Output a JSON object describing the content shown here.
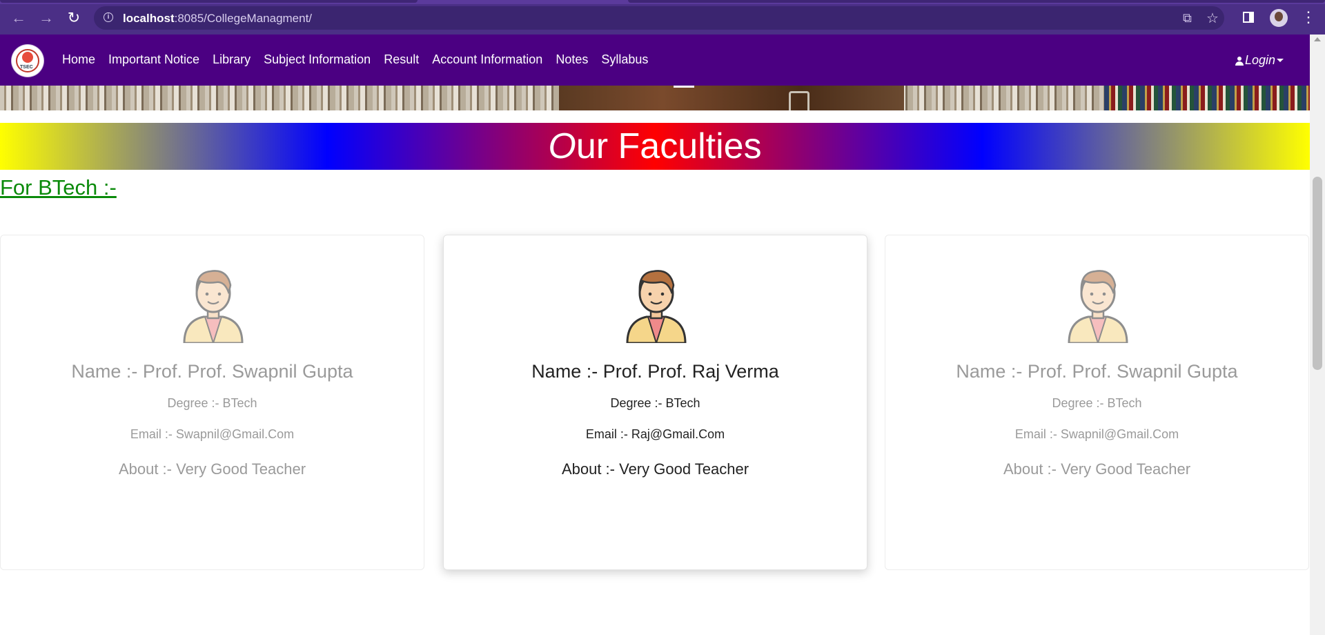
{
  "browser": {
    "url_host": "localhost",
    "url_rest": ":8085/CollegeManagment/",
    "icons": [
      "back-icon",
      "forward-icon",
      "reload-icon",
      "info-icon",
      "share-icon",
      "star-icon",
      "side-panel-icon",
      "profile-avatar",
      "kebab-menu-icon"
    ]
  },
  "navbar": {
    "logo_text": "TSEC",
    "links": [
      "Home",
      "Important Notice",
      "Library",
      "Subject Information",
      "Result",
      "Account Information",
      "Notes",
      "Syllabus"
    ],
    "login_label": "Login",
    "bg_color": "#4b0082"
  },
  "banner": {
    "title_first": "O",
    "title_rest": "ur Faculties"
  },
  "section": {
    "title": "For BTech :-"
  },
  "faculty": [
    {
      "name": "Name :- Prof. Prof. Swapnil Gupta",
      "degree": "Degree :- BTech",
      "email": "Email :- Swapnil@Gmail.Com",
      "about": "About :- Very Good Teacher"
    },
    {
      "name": "Name :- Prof. Prof. Raj Verma",
      "degree": "Degree :- BTech",
      "email": "Email :- Raj@Gmail.Com",
      "about": "About :- Very Good Teacher"
    },
    {
      "name": "Name :- Prof. Prof. Swapnil Gupta",
      "degree": "Degree :- BTech",
      "email": "Email :- Swapnil@Gmail.Com",
      "about": "About :- Very Good Teacher"
    }
  ]
}
